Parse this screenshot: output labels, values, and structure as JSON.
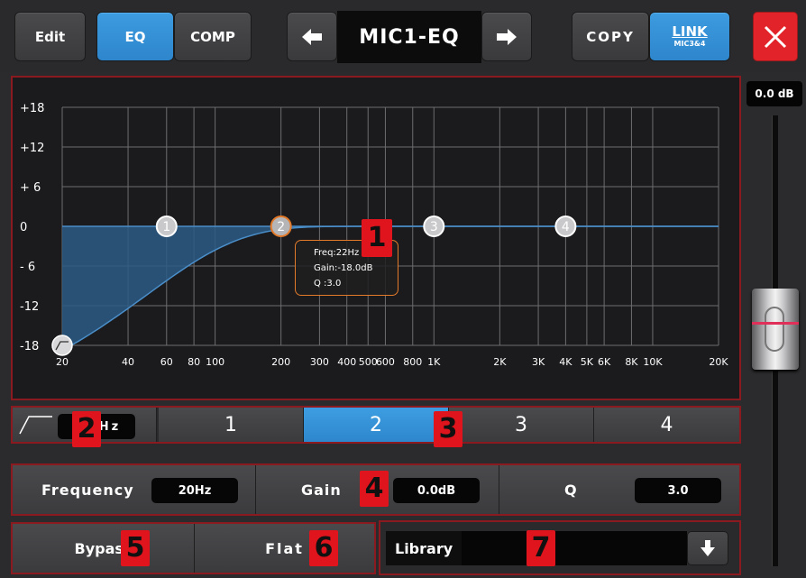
{
  "toolbar": {
    "edit_label": "Edit",
    "eq_label": "EQ",
    "comp_label": "COMP",
    "title": "MIC1-EQ",
    "copy_label": "COPY",
    "link_label": "LINK",
    "link_sub": "MIC3&4"
  },
  "graph": {
    "y_ticks": [
      "+18",
      "+12",
      "+ 6",
      "0",
      "- 6",
      "-12",
      "-18"
    ],
    "x_ticks": [
      "20",
      "40",
      "60",
      "80",
      "100",
      "200",
      "300",
      "400",
      "500",
      "600",
      "800",
      "1K",
      "2K",
      "3K",
      "4K",
      "5K",
      "6K",
      "8K",
      "10K",
      "20K"
    ],
    "points": [
      "1",
      "2",
      "3",
      "4"
    ],
    "callout": {
      "freq": "Freq:22Hz",
      "gain": "Gain:-18.0dB",
      "q": "Q  :3.0"
    },
    "active_point": "2",
    "colors": {
      "curve": "#4a8ec9",
      "fill": "#2c5a85",
      "active_point": "#e37a2a"
    }
  },
  "markers": [
    "1",
    "2",
    "3",
    "4",
    "5",
    "6",
    "7"
  ],
  "band_row": {
    "filter_value": "Hz",
    "bands": [
      "1",
      "2",
      "3",
      "4"
    ],
    "selected": "2"
  },
  "params": {
    "frequency_label": "Frequency",
    "frequency_value": "20Hz",
    "gain_label": "Gain",
    "gain_value": "0.0dB",
    "q_label": "Q",
    "q_value": "3.0"
  },
  "actions": {
    "bypass_label": "Bypass",
    "flat_label": "Flat",
    "library_label": "Library"
  },
  "fader": {
    "readout": "0.0 dB"
  }
}
